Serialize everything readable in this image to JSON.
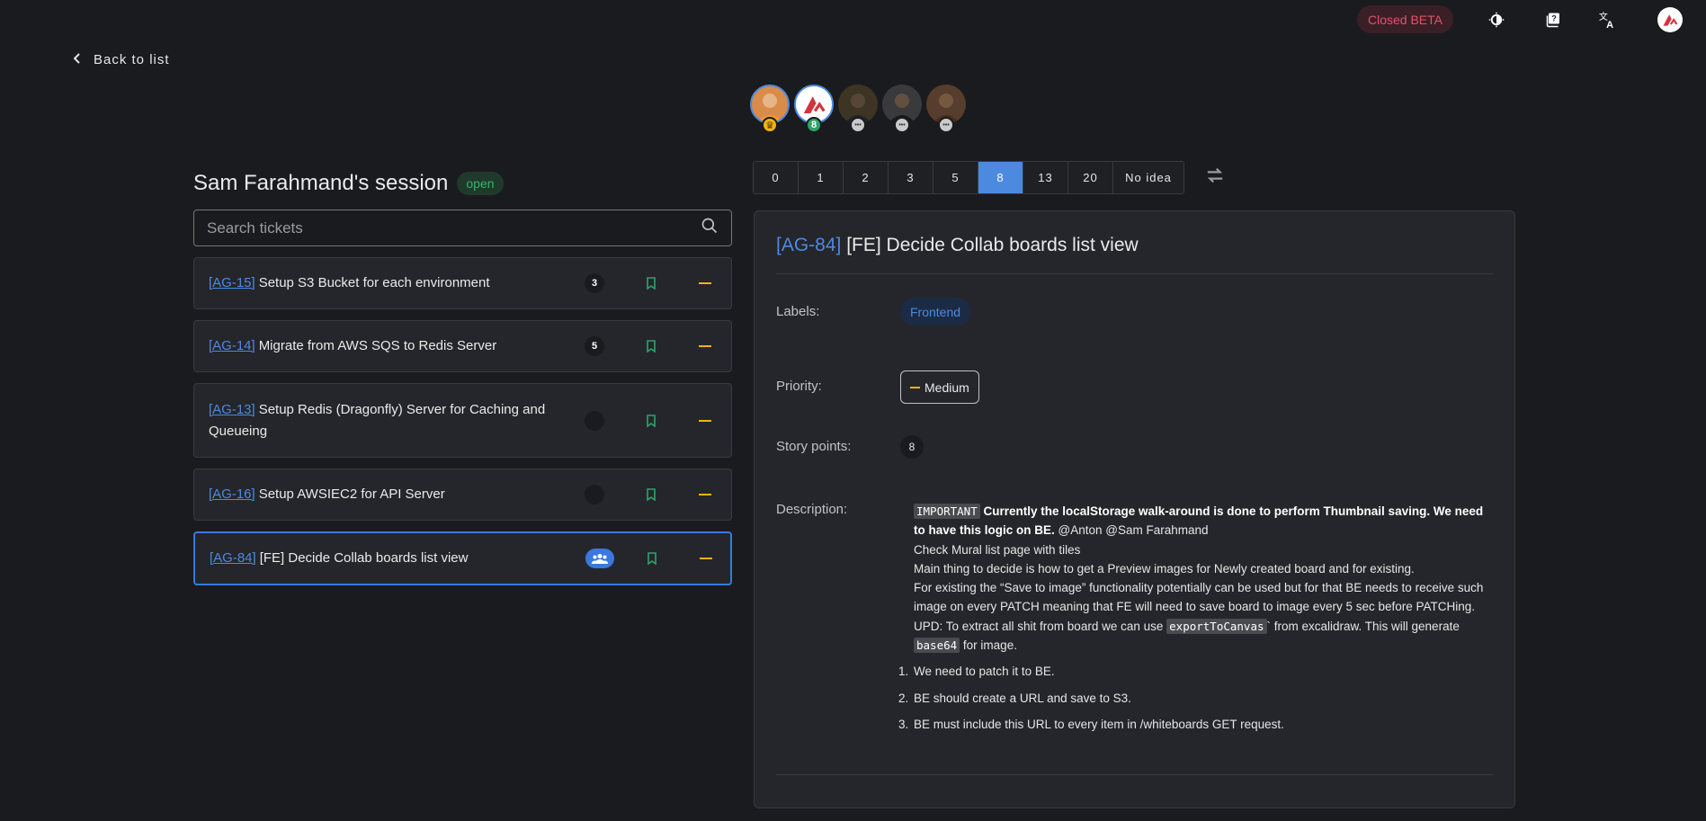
{
  "topbar": {
    "beta_label": "Closed BETA",
    "icons": [
      "theme-toggle-icon",
      "help-icon",
      "translate-icon",
      "user-avatar"
    ]
  },
  "back": {
    "label": "Back to list"
  },
  "participants": [
    {
      "badge": "♛",
      "kind": "crown",
      "active": true
    },
    {
      "badge": "8",
      "kind": "voted",
      "active": true
    },
    {
      "badge": "•••",
      "kind": "wait",
      "active": false
    },
    {
      "badge": "•••",
      "kind": "wait",
      "active": false
    },
    {
      "badge": "•••",
      "kind": "wait",
      "active": false
    }
  ],
  "session": {
    "title": "Sam Farahmand's session",
    "status": "open"
  },
  "search": {
    "placeholder": "Search tickets"
  },
  "tickets": [
    {
      "key": "[AG-15]",
      "title": "Setup S3 Bucket for each environment",
      "score": "3"
    },
    {
      "key": "[AG-14]",
      "title": "Migrate from AWS SQS to Redis Server",
      "score": "5"
    },
    {
      "key": "[AG-13]",
      "title": "Setup Redis (Dragonfly) Server for Caching and Queueing",
      "score": ""
    },
    {
      "key": "[AG-16]",
      "title": "Setup AWSIEC2 for API Server",
      "score": ""
    },
    {
      "key": "[AG-84]",
      "title": "[FE] Decide Collab boards list view",
      "score": "team"
    }
  ],
  "points": [
    "0",
    "1",
    "2",
    "3",
    "5",
    "8",
    "13",
    "20",
    "No idea"
  ],
  "selected_point": "8",
  "detail": {
    "key": "[AG-84]",
    "title": "[FE] Decide Collab boards list view",
    "labels_label": "Labels:",
    "label_value": "Frontend",
    "priority_label": "Priority:",
    "priority_value": "Medium",
    "story_points_label": "Story points:",
    "story_points_value": "8",
    "description_label": "Description:",
    "description": {
      "important_tag": "IMPORTANT",
      "important_text": "Currently the localStorage walk-around is done to perform Thumbnail saving. We need to have this logic on BE.",
      "mentions": "@Anton @Sam Farahmand",
      "line1": "Check Mural list page with tiles",
      "line2": "Main thing to decide is how to get a Preview images for Newly created board and for existing.",
      "line3": "For existing the “Save to image” functionality potentially can be used but for that BE needs to receive such image on every PATCH meaning that FE will need to save board to image every 5 sec before PATCHing.",
      "upd_prefix": "UPD: To extract all shit from board we can use",
      "upd_code": "exportToCanvas",
      "upd_suffix": "` from excalidraw. This will generate",
      "upd_code2": "base64",
      "upd_end": "for image.",
      "steps": [
        "We need to patch it to BE.",
        "BE should create a URL and save to S3.",
        "BE must include this URL to every item in /whiteboards GET request."
      ]
    }
  }
}
